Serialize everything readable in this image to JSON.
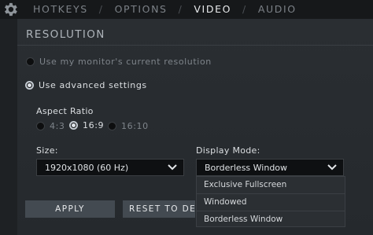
{
  "tabs": [
    {
      "label": "HOTKEYS"
    },
    {
      "label": "OPTIONS"
    },
    {
      "label": "VIDEO"
    },
    {
      "label": "AUDIO"
    }
  ],
  "separator": "/",
  "active_tab": "VIDEO",
  "resolution": {
    "title": "RESOLUTION",
    "use_monitor_label": "Use my monitor's current resolution",
    "use_advanced_label": "Use advanced settings",
    "selected_mode": "advanced"
  },
  "aspect_ratio": {
    "label": "Aspect Ratio",
    "options": [
      "4:3",
      "16:9",
      "16:10"
    ],
    "selected": "16:9"
  },
  "size": {
    "label": "Size:",
    "value": "1920x1080 (60 Hz)"
  },
  "display_mode": {
    "label": "Display Mode:",
    "value": "Borderless Window",
    "options": [
      "Exclusive Fullscreen",
      "Windowed",
      "Borderless Window"
    ]
  },
  "buttons": {
    "apply": "APPLY",
    "reset": "RESET TO DEFAU"
  },
  "colors": {
    "background": "#1e2124",
    "panel": "#2a2e32",
    "button": "#434a51",
    "select_bg": "#0e1012"
  }
}
